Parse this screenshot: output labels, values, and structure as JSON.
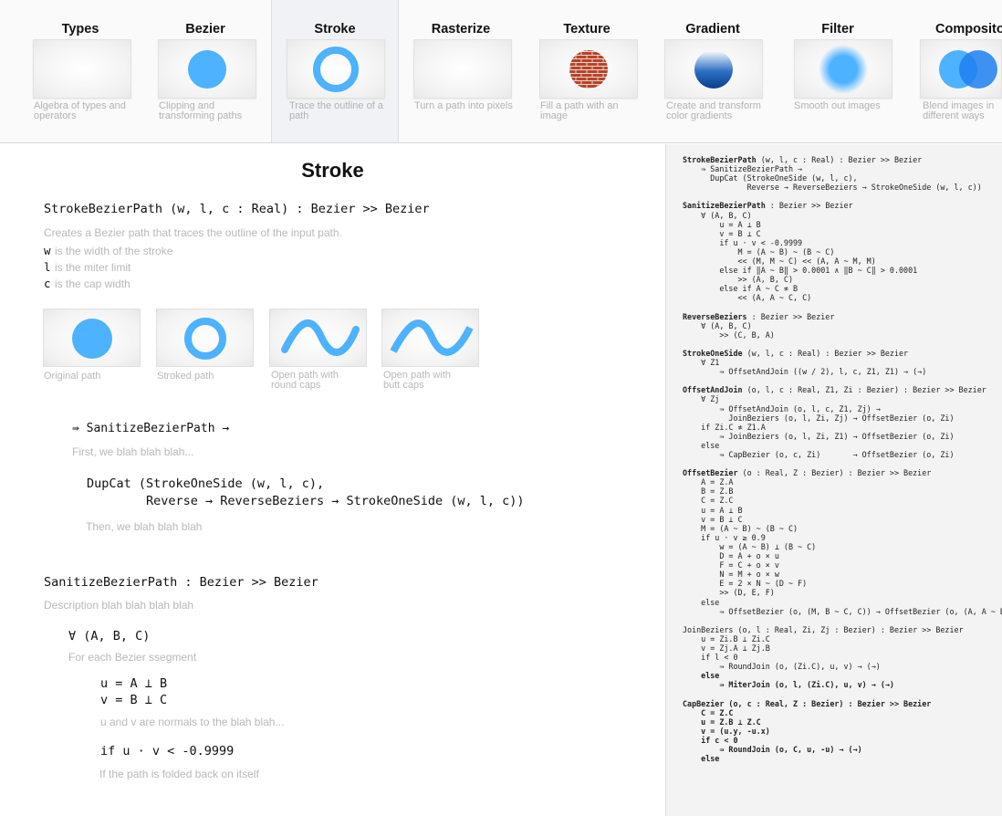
{
  "nav": [
    {
      "title": "Types",
      "desc": "Algebra of types and operators",
      "icon": "types-thumb-icon"
    },
    {
      "title": "Bezier",
      "desc": "Clipping and transforming paths",
      "icon": "blue-circle-icon"
    },
    {
      "title": "Stroke",
      "desc": "Trace the outline of a path",
      "icon": "blue-ring-icon",
      "active": true
    },
    {
      "title": "Rasterize",
      "desc": "Turn a path into pixels",
      "icon": "rasterize-thumb-icon"
    },
    {
      "title": "Texture",
      "desc": "Fill a path with an image",
      "icon": "brick-texture-circle-icon"
    },
    {
      "title": "Gradient",
      "desc": "Create and transform color gradients",
      "icon": "gradient-circle-icon"
    },
    {
      "title": "Filter",
      "desc": "Smooth out images",
      "icon": "blurred-circle-icon"
    },
    {
      "title": "Compositor",
      "desc": "Blend images in different ways",
      "icon": "overlapping-circles-icon"
    }
  ],
  "colors": {
    "accent": "#4db2ff",
    "accent_dark": "#2f8fe6",
    "panel": "#f3f3f3"
  },
  "main": {
    "title": "Stroke",
    "signature": "StrokeBezierPath (w, l, c : Real) : Bezier >> Bezier",
    "intro": "Creates a Bezier path that traces the outline of the input path.",
    "params": [
      {
        "name": "w",
        "desc": "is the width of the stroke"
      },
      {
        "name": "l",
        "desc": "is the miter limit"
      },
      {
        "name": "c",
        "desc": "is the cap width"
      }
    ],
    "examples": [
      {
        "caption": "Original path"
      },
      {
        "caption": "Stroked path"
      },
      {
        "caption": "Open path with round caps"
      },
      {
        "caption": "Open path with butt caps"
      }
    ],
    "step1_code": "⇛ SanitizeBezierPath →",
    "step1_note": "First, we blah blah blah...",
    "dupcat_line1": "DupCat (StrokeOneSide (w, l, c),",
    "dupcat_line2": "        Reverse → ReverseBeziers → StrokeOneSide (w, l, c))",
    "dupcat_note": "Then, we blah blah blah",
    "sanitize_sig": "SanitizeBezierPath : Bezier >> Bezier",
    "sanitize_desc": "Description blah blah blah blah",
    "forall_code": "∀ (A, B, C)",
    "forall_note": "For each Bezier ssegment",
    "uv_line1": "u = A ⊥ B",
    "uv_line2": "v = B ⊥ C",
    "uv_note": "u and v are normals to the blah blah...",
    "if_code": "if u · v < -0.9999",
    "if_note": "If the path is folded back on itself"
  },
  "code_panel": {
    "lines": [
      {
        "b": "StrokeBezierPath",
        "t": " (w, l, c : Real) : Bezier >> Bezier"
      },
      {
        "t": "    ⇛ SanitizeBezierPath →"
      },
      {
        "t": "      DupCat (StrokeOneSide (w, l, c),"
      },
      {
        "t": "              Reverse → ReverseBeziers → StrokeOneSide (w, l, c))"
      },
      {
        "t": ""
      },
      {
        "b": "SanitizeBezierPath",
        "t": " : Bezier >> Bezier"
      },
      {
        "t": "    ∀ (A, B, C)"
      },
      {
        "t": "        u = A ⊥ B"
      },
      {
        "t": "        v = B ⊥ C"
      },
      {
        "t": "        if u · v < -0.9999"
      },
      {
        "t": "            M = (A ~ B) ~ (B ~ C)"
      },
      {
        "t": "            << (M, M ~ C) << (A, A ~ M, M)"
      },
      {
        "t": "        else if ‖A ~ B‖ > 0.0001 ∧ ‖B ~ C‖ > 0.0001"
      },
      {
        "t": "            >> (A, B, C)"
      },
      {
        "t": "        else if A ~ C ≉ B"
      },
      {
        "t": "            << (A, A ~ C, C)"
      },
      {
        "t": ""
      },
      {
        "b": "ReverseBeziers",
        "t": " : Bezier >> Bezier"
      },
      {
        "t": "    ∀ (A, B, C)"
      },
      {
        "t": "        >> (C, B, A)"
      },
      {
        "t": ""
      },
      {
        "b": "StrokeOneSide",
        "t": " (w, l, c : Real) : Bezier >> Bezier"
      },
      {
        "t": "    ∀ Z1"
      },
      {
        "t": "        ⇛ OffsetAndJoin ((w / 2), l, c, Z1, Z1) → (→)"
      },
      {
        "t": ""
      },
      {
        "b": "OffsetAndJoin",
        "t": " (o, l, c : Real, Z1, Zi : Bezier) : Bezier >> Bezier"
      },
      {
        "t": "    ∀ Zj"
      },
      {
        "t": "        ⇛ OffsetAndJoin (o, l, c, Z1, Zj) →"
      },
      {
        "t": "          JoinBeziers (o, l, Zi, Zj) → OffsetBezier (o, Zi)"
      },
      {
        "t": "    if Zi.C ≉ Z1.A"
      },
      {
        "t": "        ⇛ JoinBeziers (o, l, Zi, Z1) → OffsetBezier (o, Zi)"
      },
      {
        "t": "    else"
      },
      {
        "t": "        ⇛ CapBezier (o, c, Zi)       → OffsetBezier (o, Zi)"
      },
      {
        "t": ""
      },
      {
        "b": "OffsetBezier",
        "t": " (o : Real, Z : Bezier) : Bezier >> Bezier"
      },
      {
        "t": "    A = Z.A"
      },
      {
        "t": "    B = Z.B"
      },
      {
        "t": "    C = Z.C"
      },
      {
        "t": "    u = A ⊥ B"
      },
      {
        "t": "    v = B ⊥ C"
      },
      {
        "t": "    M = (A ~ B) ~ (B ~ C)"
      },
      {
        "t": "    if u · v ≥ 0.9"
      },
      {
        "t": "        w = (A ~ B) ⊥ (B ~ C)"
      },
      {
        "t": "        D = A + o × u"
      },
      {
        "t": "        F = C + o × v"
      },
      {
        "t": "        N = M + o × w"
      },
      {
        "t": "        E = 2 × N ~ (D ~ F)"
      },
      {
        "t": "        >> (D, E, F)"
      },
      {
        "t": "    else"
      },
      {
        "t": "        ⇛ OffsetBezier (o, (M, B ~ C, C)) → OffsetBezier (o, (A, A ~ B, M))"
      },
      {
        "t": ""
      },
      {
        "t": "JoinBeziers (o, l : Real, Zi, Zj : Bezier) : Bezier >> Bezier"
      },
      {
        "t": "    u = Zi.B ⊥ Zi.C"
      },
      {
        "t": "    v = Zj.A ⊥ Zj.B"
      },
      {
        "t": "    if l < 0"
      },
      {
        "t": "        ⇛ RoundJoin (o, (Zi.C), u, v) → (→)"
      },
      {
        "b": "    else"
      },
      {
        "b": "        ⇛ MiterJoin (o, l, (Zi.C), u, v) → (→)"
      },
      {
        "t": ""
      },
      {
        "b": "CapBezier (o, c : Real, Z : Bezier) : Bezier >> Bezier"
      },
      {
        "b": "    C = Z.C"
      },
      {
        "b": "    u = Z.B ⊥ Z.C"
      },
      {
        "b": "    v = (u.y, -u.x)"
      },
      {
        "b": "    if c < 0"
      },
      {
        "b": "        ⇛ RoundJoin (o, C, u, -u) → (→)"
      },
      {
        "b": "    else"
      }
    ]
  }
}
